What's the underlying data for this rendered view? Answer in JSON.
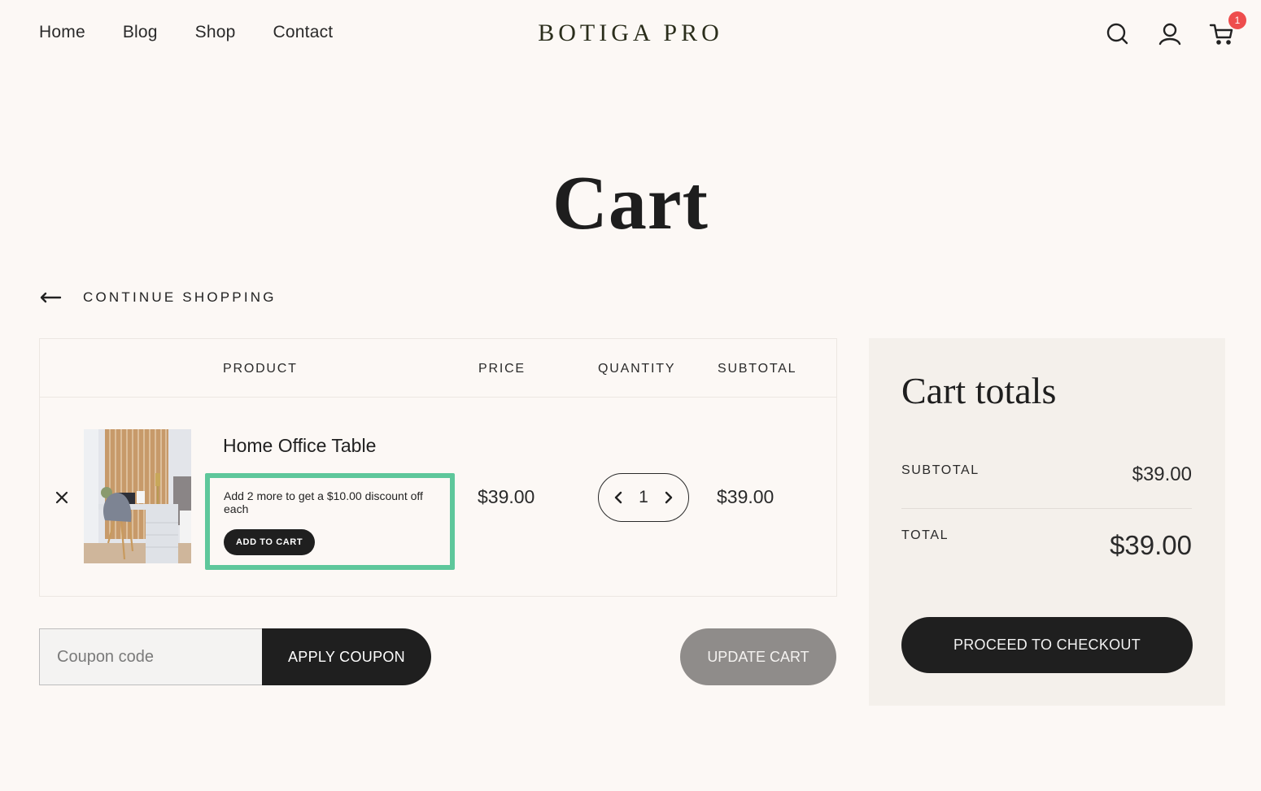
{
  "header": {
    "nav": [
      {
        "label": "Home"
      },
      {
        "label": "Blog"
      },
      {
        "label": "Shop"
      },
      {
        "label": "Contact"
      }
    ],
    "logo": "BOTIGA PRO",
    "icons": [
      "search-icon",
      "account-icon",
      "cart-icon"
    ],
    "cart_count": "1",
    "badge_color": "#ee4d4d"
  },
  "page": {
    "title": "Cart",
    "continue_shopping": "CONTINUE SHOPPING"
  },
  "table": {
    "headers": {
      "product": "PRODUCT",
      "price": "PRICE",
      "quantity": "QUANTITY",
      "subtotal": "SUBTOTAL"
    },
    "items": [
      {
        "name": "Home Office Table",
        "price": "$39.00",
        "quantity": "1",
        "subtotal": "$39.00",
        "promo_message": "Add 2 more to get a $10.00 discount off each",
        "promo_button": "ADD TO CART",
        "promo_border_color": "#5ec79b"
      }
    ]
  },
  "coupon": {
    "placeholder": "Coupon code",
    "value": "",
    "apply_label": "APPLY COUPON"
  },
  "update_cart_label": "UPDATE CART",
  "totals": {
    "title": "Cart totals",
    "subtotal_label": "SUBTOTAL",
    "subtotal_value": "$39.00",
    "total_label": "TOTAL",
    "total_value": "$39.00",
    "checkout_label": "PROCEED TO CHECKOUT"
  }
}
